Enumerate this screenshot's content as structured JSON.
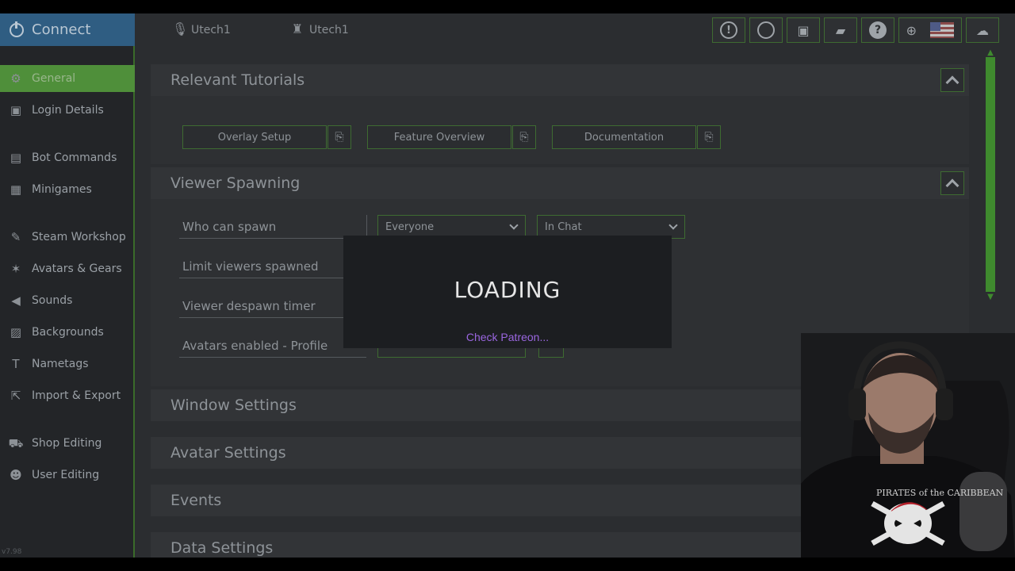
{
  "sidebar": {
    "connect_label": "Connect",
    "version": "v7.98",
    "items": [
      {
        "label": "General",
        "icon": "gear-icon"
      },
      {
        "label": "Login Details",
        "icon": "id-card-icon"
      },
      {
        "label": "Bot Commands",
        "icon": "terminal-icon"
      },
      {
        "label": "Minigames",
        "icon": "gamepad-icon"
      },
      {
        "label": "Steam Workshop",
        "icon": "wrench-icon"
      },
      {
        "label": "Avatars & Gears",
        "icon": "figure-icon"
      },
      {
        "label": "Sounds",
        "icon": "speaker-icon"
      },
      {
        "label": "Backgrounds",
        "icon": "image-icon"
      },
      {
        "label": "Nametags",
        "icon": "text-icon"
      },
      {
        "label": "Import & Export",
        "icon": "export-icon"
      },
      {
        "label": "Shop Editing",
        "icon": "cart-icon"
      },
      {
        "label": "User Editing",
        "icon": "user-icon"
      }
    ]
  },
  "topbar": {
    "streamer_name": "Utech1",
    "bot_name": "Utech1",
    "buttons": [
      "alert-icon",
      "refresh-icon",
      "save-icon",
      "folder-icon",
      "help-icon",
      "globe-icon",
      "flag-icon",
      "cloud-icon"
    ]
  },
  "sections": {
    "tutorials": {
      "title": "Relevant Tutorials",
      "buttons": [
        "Overlay Setup",
        "Feature Overview",
        "Documentation"
      ]
    },
    "viewer_spawning": {
      "title": "Viewer Spawning",
      "fields": [
        "Who can spawn",
        "Limit viewers spawned",
        "Viewer despawn timer",
        "Avatars enabled - Profile"
      ],
      "who_can_spawn_value": "Everyone",
      "where_value": "In Chat"
    },
    "collapsed": [
      "Window Settings",
      "Avatar Settings",
      "Events",
      "Data Settings"
    ]
  },
  "loading": {
    "title": "LOADING",
    "status": "Check Patreon..."
  },
  "colors": {
    "accent_green": "#4f8f3a",
    "connect_blue": "#2f5d82",
    "loading_purple": "#9a66e0"
  }
}
